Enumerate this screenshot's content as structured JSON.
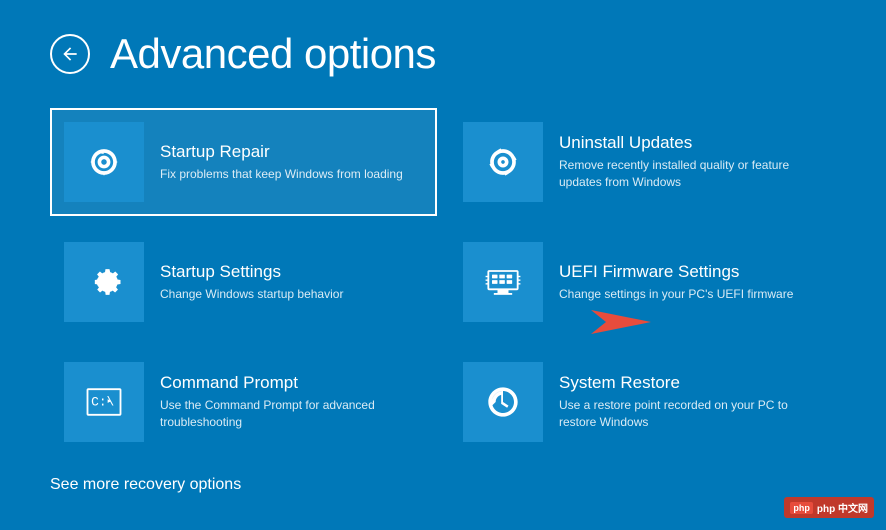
{
  "page": {
    "title": "Advanced options",
    "background_color": "#0078b8"
  },
  "back_button": {
    "label": "←"
  },
  "options": [
    {
      "id": "startup-repair",
      "title": "Startup Repair",
      "description": "Fix problems that keep Windows from loading",
      "icon": "startup-repair",
      "selected": true
    },
    {
      "id": "uninstall-updates",
      "title": "Uninstall Updates",
      "description": "Remove recently installed quality or feature updates from Windows",
      "icon": "uninstall-updates",
      "selected": false
    },
    {
      "id": "startup-settings",
      "title": "Startup Settings",
      "description": "Change Windows startup behavior",
      "icon": "startup-settings",
      "selected": false
    },
    {
      "id": "uefi-firmware",
      "title": "UEFI Firmware Settings",
      "description": "Change settings in your PC's UEFI firmware",
      "icon": "uefi-firmware",
      "selected": false
    },
    {
      "id": "command-prompt",
      "title": "Command Prompt",
      "description": "Use the Command Prompt for advanced troubleshooting",
      "icon": "command-prompt",
      "selected": false
    },
    {
      "id": "system-restore",
      "title": "System Restore",
      "description": "Use a restore point recorded on your PC to restore Windows",
      "icon": "system-restore",
      "selected": false
    }
  ],
  "see_more": {
    "label": "See more recovery options"
  },
  "watermark": {
    "text": "php 中文网"
  }
}
